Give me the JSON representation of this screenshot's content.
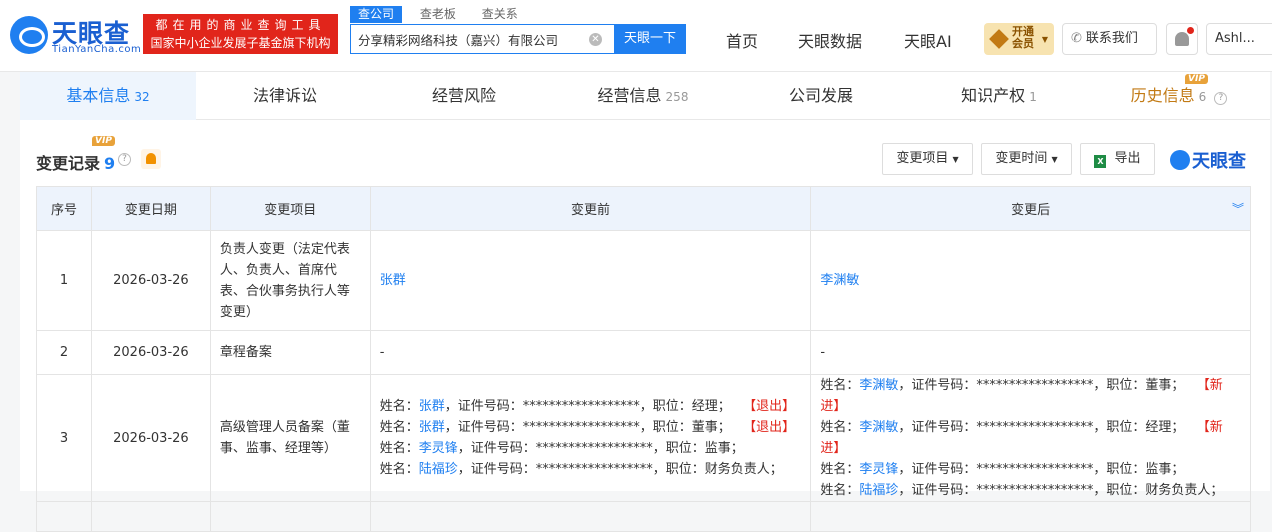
{
  "header": {
    "logo_text": "天眼查",
    "logo_sub": "TianYanCha.com",
    "slogan_line1": "都在用的商业查询工具",
    "slogan_line2": "国家中小企业发展子基金旗下机构",
    "search_tabs": [
      "查公司",
      "查老板",
      "查关系"
    ],
    "search_value": "分享精彩网络科技（嘉兴）有限公司",
    "search_button": "天眼一下",
    "nav": [
      "首页",
      "天眼数据",
      "天眼AI"
    ],
    "vip_line1": "开通",
    "vip_line2": "会员",
    "contact": "联系我们",
    "user": "Ashl..."
  },
  "tabs": [
    {
      "label": "基本信息",
      "count": "32"
    },
    {
      "label": "法律诉讼",
      "count": ""
    },
    {
      "label": "经营风险",
      "count": ""
    },
    {
      "label": "经营信息",
      "count": "258"
    },
    {
      "label": "公司发展",
      "count": ""
    },
    {
      "label": "知识产权",
      "count": "1"
    },
    {
      "label": "历史信息",
      "count": "6"
    }
  ],
  "vip_badge": "VIP",
  "section": {
    "title": "变更记录",
    "count": "9",
    "filter_item": "变更项目",
    "filter_time": "变更时间",
    "export": "导出",
    "brand": "天眼查"
  },
  "table": {
    "headers": [
      "序号",
      "变更日期",
      "变更项目",
      "变更前",
      "变更后"
    ],
    "rows": [
      {
        "no": "1",
        "date": "2026-03-26",
        "item": "负责人变更（法定代表人、负责人、首席代表、合伙事务执行人等变更）",
        "before": "张群",
        "after": "李渊敏"
      },
      {
        "no": "2",
        "date": "2026-03-26",
        "item": "章程备案",
        "before": "-",
        "after": "-"
      },
      {
        "no": "3",
        "date": "2026-03-26",
        "item": "高级管理人员备案（董事、监事、经理等）",
        "before_lines": [
          {
            "pre": "姓名：",
            "name": "张群",
            "mid": "，证件号码：******************，职位：经理；",
            "tag": "【退出】"
          },
          {
            "pre": "姓名：",
            "name": "张群",
            "mid": "，证件号码：******************，职位：董事；",
            "tag": "【退出】"
          },
          {
            "pre": "姓名：",
            "name": "李灵锋",
            "mid": "，证件号码：******************，职位：监事；",
            "tag": ""
          },
          {
            "pre": "姓名：",
            "name": "陆福珍",
            "mid": "，证件号码：******************，职位：财务负责人；",
            "tag": ""
          }
        ],
        "after_lines": [
          {
            "pre": "姓名：",
            "name": "李渊敏",
            "mid": "，证件号码：******************，职位：董事；",
            "tag": "【新进】"
          },
          {
            "pre": "姓名：",
            "name": "李渊敏",
            "mid": "，证件号码：******************，职位：经理；",
            "tag": "【新进】"
          },
          {
            "pre": "姓名：",
            "name": "李灵锋",
            "mid": "，证件号码：******************，职位：监事；",
            "tag": ""
          },
          {
            "pre": "姓名：",
            "name": "陆福珍",
            "mid": "，证件号码：******************，职位：财务负责人；",
            "tag": ""
          }
        ]
      }
    ]
  }
}
